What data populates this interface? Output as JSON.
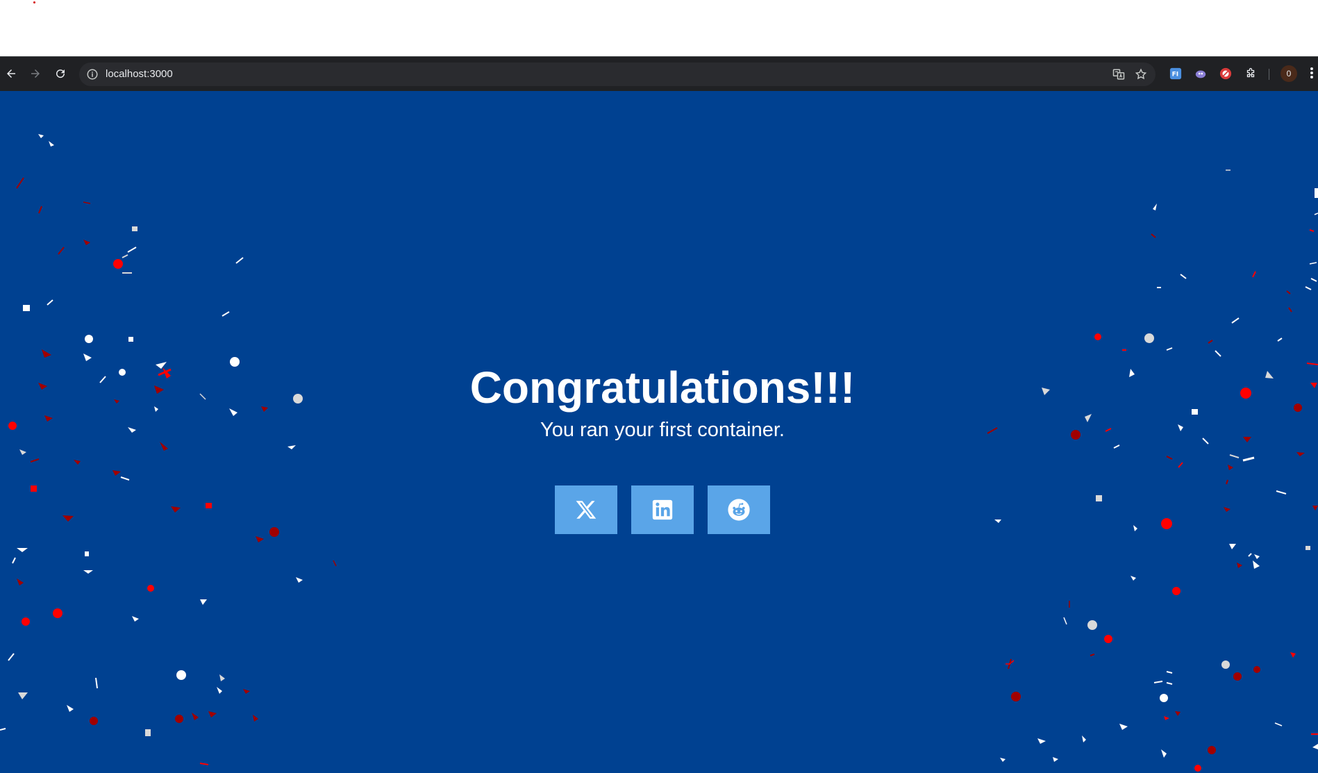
{
  "browser": {
    "url": "localhost:3000",
    "profile_initial": "0"
  },
  "page": {
    "headline": "Congratulations!!!",
    "subline": "You ran your first container.",
    "share_buttons": [
      {
        "icon": "x-twitter-icon"
      },
      {
        "icon": "linkedin-icon"
      },
      {
        "icon": "reddit-icon"
      }
    ]
  },
  "colors": {
    "page_background": "#004191",
    "button_background": "#5aa5e8",
    "confetti": [
      "#ffffff",
      "#d9d9d9",
      "#ff0000",
      "#a00000"
    ]
  }
}
